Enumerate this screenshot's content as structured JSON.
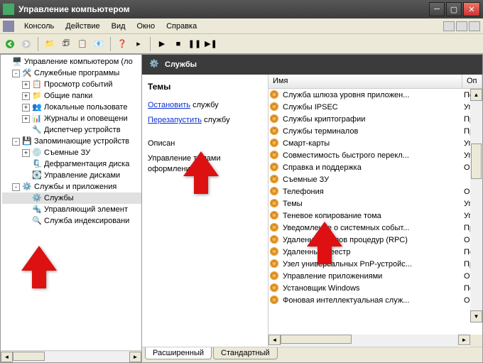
{
  "window": {
    "title": "Управление компьютером"
  },
  "menu": {
    "console": "Консоль",
    "action": "Действие",
    "view": "Вид",
    "window": "Окно",
    "help": "Справка"
  },
  "tree": {
    "root": "Управление компьютером (ло",
    "sys_tools": "Служебные программы",
    "event_viewer": "Просмотр событий",
    "shared_folders": "Общие папки",
    "local_users": "Локальные пользовате",
    "perf_logs": "Журналы и оповещени",
    "device_mgr": "Диспетчер устройств",
    "storage": "Запоминающие устройств",
    "removable": "Съемные ЗУ",
    "defrag": "Дефрагментация диска",
    "disk_mgmt": "Управление дисками",
    "services_apps": "Службы и приложения",
    "services": "Службы",
    "wmi": "Управляющий элемент",
    "indexing": "Служба индексировани"
  },
  "panel": {
    "title": "Службы",
    "selected_name": "Темы",
    "stop_link": "Остановить",
    "stop_suffix": " службу",
    "restart_link": "Перезапустить",
    "restart_suffix": " службу",
    "desc_label": "Описан",
    "desc_text": "Управление темами оформления."
  },
  "list": {
    "col_name": "Имя",
    "col_desc": "Оп",
    "items": [
      {
        "name": "Служба шлюза уровня приложен...",
        "desc": "По..."
      },
      {
        "name": "Службы IPSEC",
        "desc": "Уп"
      },
      {
        "name": "Службы криптографии",
        "desc": "Пр"
      },
      {
        "name": "Службы терминалов",
        "desc": "Пр"
      },
      {
        "name": "Смарт-карты",
        "desc": "Уп"
      },
      {
        "name": "Совместимость быстрого перекл...",
        "desc": "Уп"
      },
      {
        "name": "Справка и поддержка",
        "desc": "Об"
      },
      {
        "name": "Съемные ЗУ",
        "desc": ""
      },
      {
        "name": "Телефония",
        "desc": "Об"
      },
      {
        "name": "Темы",
        "desc": "Уп"
      },
      {
        "name": "Теневое копирование тома",
        "desc": "Уп"
      },
      {
        "name": "Уведомление о системных событ...",
        "desc": "Пр"
      },
      {
        "name": "Удаленный вызов процедур (RPC)",
        "desc": "Об"
      },
      {
        "name": "Удаленный реестр",
        "desc": "По..."
      },
      {
        "name": "Узел универсальных PnP-устройс...",
        "desc": "Пр"
      },
      {
        "name": "Управление приложениями",
        "desc": "Об"
      },
      {
        "name": "Установщик Windows",
        "desc": "По..."
      },
      {
        "name": "Фоновая интеллектуальная служ...",
        "desc": "Об"
      }
    ]
  },
  "tabs": {
    "extended": "Расширенный",
    "standard": "Стандартный"
  }
}
